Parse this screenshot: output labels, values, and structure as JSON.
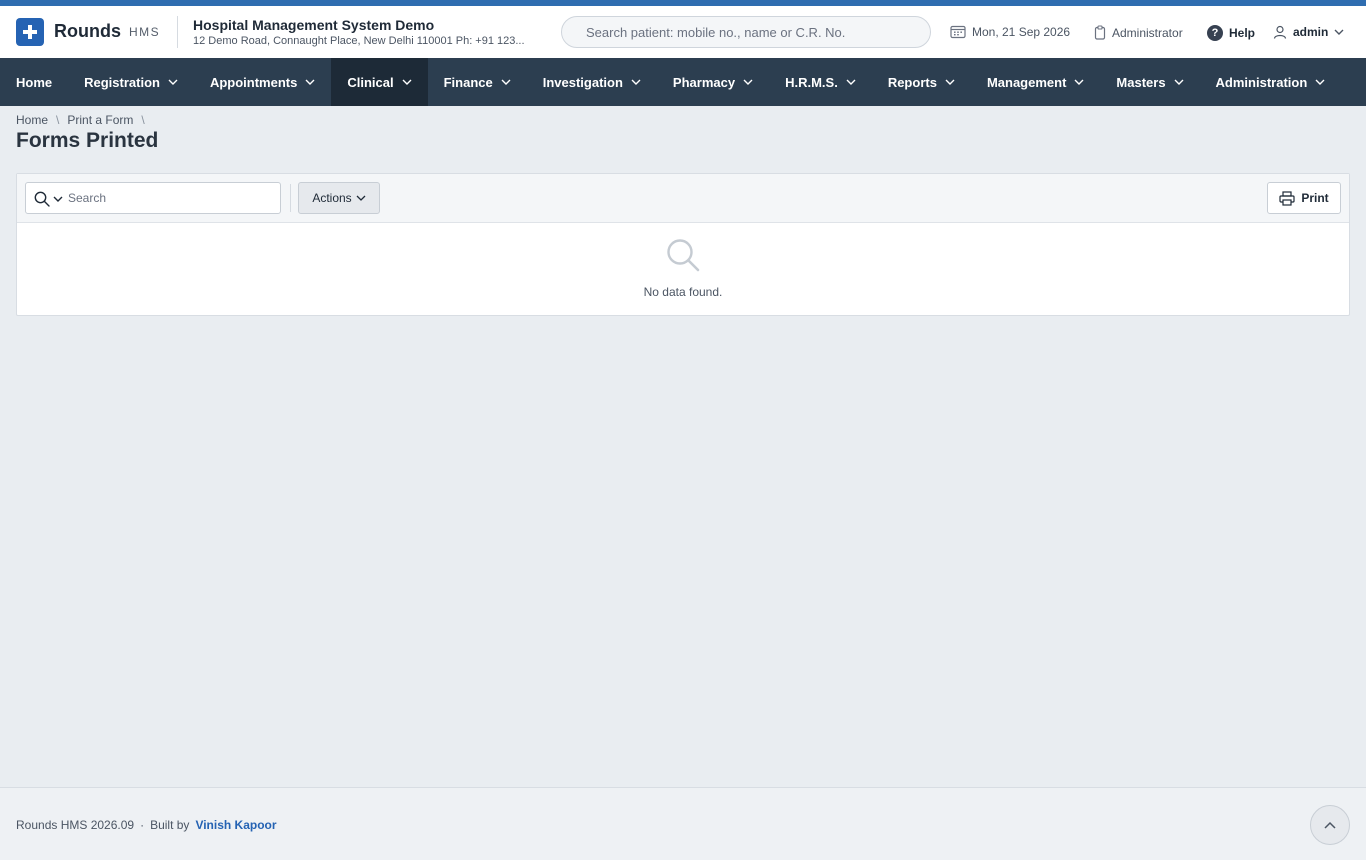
{
  "app": {
    "brand": "Rounds",
    "brand_sub": "HMS",
    "org_name": "Hospital Management System Demo",
    "org_address": "12 Demo Road, Connaught Place, New Delhi 110001 Ph: +91 123..."
  },
  "header": {
    "patient_search_placeholder": "Search patient: mobile no., name or C.R. No.",
    "date": "Mon, 21 Sep 2026",
    "role": "Administrator",
    "help": "Help",
    "user": "admin"
  },
  "nav": {
    "items": [
      {
        "label": "Home",
        "dropdown": false
      },
      {
        "label": "Registration",
        "dropdown": true
      },
      {
        "label": "Appointments",
        "dropdown": true
      },
      {
        "label": "Clinical",
        "dropdown": true,
        "active": true
      },
      {
        "label": "Finance",
        "dropdown": true
      },
      {
        "label": "Investigation",
        "dropdown": true
      },
      {
        "label": "Pharmacy",
        "dropdown": true
      },
      {
        "label": "H.R.M.S.",
        "dropdown": true
      },
      {
        "label": "Reports",
        "dropdown": true
      },
      {
        "label": "Management",
        "dropdown": true
      },
      {
        "label": "Masters",
        "dropdown": true
      },
      {
        "label": "Administration",
        "dropdown": true
      }
    ]
  },
  "breadcrumb": {
    "items": [
      "Home",
      "Print a Form"
    ],
    "separator": "\\"
  },
  "page": {
    "title": "Forms Printed"
  },
  "toolbar": {
    "search_placeholder": "Search",
    "actions_label": "Actions",
    "print_label": "Print"
  },
  "empty_state": {
    "message": "No data found."
  },
  "footer": {
    "version": "Rounds HMS 2026.09",
    "dot": "·",
    "built_by": "Built by",
    "author": "Vinish Kapoor"
  },
  "colors": {
    "accent": "#2563b3",
    "navbar": "#2c3e50",
    "navbar_active": "#1d2a37"
  }
}
